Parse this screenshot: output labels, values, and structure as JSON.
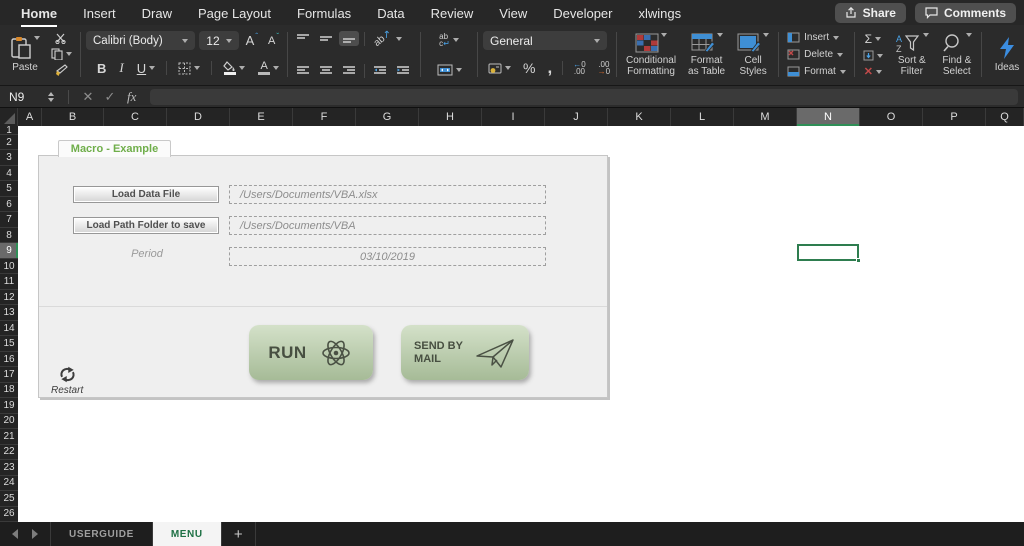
{
  "menubar": {
    "items": [
      {
        "label": "Home",
        "active": true
      },
      {
        "label": "Insert",
        "active": false
      },
      {
        "label": "Draw",
        "active": false
      },
      {
        "label": "Page Layout",
        "active": false
      },
      {
        "label": "Formulas",
        "active": false
      },
      {
        "label": "Data",
        "active": false
      },
      {
        "label": "Review",
        "active": false
      },
      {
        "label": "View",
        "active": false
      },
      {
        "label": "Developer",
        "active": false
      },
      {
        "label": "xlwings",
        "active": false
      }
    ],
    "share_label": "Share",
    "comments_label": "Comments"
  },
  "ribbon": {
    "paste_label": "Paste",
    "font_name": "Calibri (Body)",
    "font_size": "12",
    "bold": "B",
    "italic": "I",
    "underline": "U",
    "number_format": "General",
    "percent": "%",
    "comma": ",",
    "conditional_line1": "Conditional",
    "conditional_line2": "Formatting",
    "format_table_line1": "Format",
    "format_table_line2": "as Table",
    "cell_styles_line1": "Cell",
    "cell_styles_line2": "Styles",
    "insert_label": "Insert",
    "delete_label": "Delete",
    "format_label": "Format",
    "sort_line1": "Sort &",
    "sort_line2": "Filter",
    "find_line1": "Find &",
    "find_line2": "Select",
    "ideas_label": "Ideas"
  },
  "formula_bar": {
    "name_box": "N9",
    "fx": "fx",
    "formula_value": ""
  },
  "sheet": {
    "columns": [
      "A",
      "B",
      "C",
      "D",
      "E",
      "F",
      "G",
      "H",
      "I",
      "J",
      "K",
      "L",
      "M",
      "N",
      "O",
      "P",
      "Q"
    ],
    "rows": [
      1,
      2,
      3,
      4,
      5,
      6,
      7,
      8,
      9,
      10,
      11,
      12,
      13,
      14,
      15,
      16,
      17,
      18,
      19,
      20,
      21,
      22,
      23,
      24,
      25,
      26
    ],
    "selected_column": "N",
    "selected_row": 9,
    "selection_color": "#2e7d4f"
  },
  "form": {
    "title": "Macro - Example",
    "title_color": "#6fae4a",
    "load_data_button": "Load Data File",
    "load_data_value": "/Users/Documents/VBA.xlsx",
    "load_path_button": "Load Path Folder to save",
    "load_path_value": "/Users/Documents/VBA",
    "period_label": "Period",
    "period_value": "03/10/2019",
    "run_label": "RUN",
    "send_line1": "SEND BY",
    "send_line2": "MAIL",
    "restart_label": "Restart",
    "button_green": "#b8cba9"
  },
  "tabbar": {
    "tabs": [
      {
        "label": "USERGUIDE",
        "active": false
      },
      {
        "label": "MENU",
        "active": true
      }
    ],
    "add_label": "+",
    "active_tab_color": "#1d7044"
  }
}
